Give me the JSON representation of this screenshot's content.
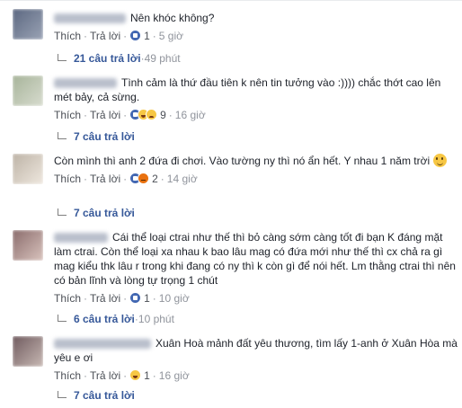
{
  "labels": {
    "like": "Thích",
    "reply": "Trả lời",
    "separator": "·"
  },
  "colors": {
    "link": "#365899",
    "like_reaction": "#4267b2",
    "muted": "#90949c"
  },
  "comments": [
    {
      "text": "Nên khóc không?",
      "reactions": [
        "like"
      ],
      "reaction_count": "1",
      "time": "5 giờ",
      "replies": "21 câu trả lời",
      "replies_time": "49 phút"
    },
    {
      "text": "Tình cảm là thứ đầu tiên k nên tin tưởng vào :)))) chắc thớt cao lên mét bảy, cả sừng.",
      "reactions": [
        "like",
        "haha",
        "sad"
      ],
      "reaction_count": "9",
      "time": "16 giờ",
      "replies": "7 câu trả lời",
      "replies_time": ""
    },
    {
      "text": "Còn mình thì anh 2 đứa đi chơi. Vào tường ny thì nó ẩn hết. Y nhau 1 năm trời",
      "emoji": "slightly-smiling-emoji",
      "reactions": [
        "like",
        "angry"
      ],
      "reaction_count": "2",
      "time": "14 giờ",
      "replies": "7 câu trả lời",
      "replies_time": ""
    },
    {
      "text": "Cái thể loại ctrai như thế thì bỏ càng sớm càng tốt đi bạn K đáng mặt làm ctrai. Còn thể loại xa nhau k bao lâu mag có đứa mới như thế thì cx chả ra gì mag kiểu thk lâu r trong khi đang có ny thì k còn gì để nói hết. Lm thằng ctrai thì nên có bản lĩnh và lòng tự trọng 1 chút",
      "reactions": [
        "like"
      ],
      "reaction_count": "1",
      "time": "10 giờ",
      "replies": "6 câu trả lời",
      "replies_time": "10 phút"
    },
    {
      "text": "Xuân Hoà mảnh đất yêu thương, tìm lấy 1-anh ở Xuân Hòa mà yêu e ơi",
      "reactions": [
        "haha"
      ],
      "reaction_count": "1",
      "time": "16 giờ",
      "replies": "7 câu trả lời",
      "replies_time": ""
    }
  ]
}
